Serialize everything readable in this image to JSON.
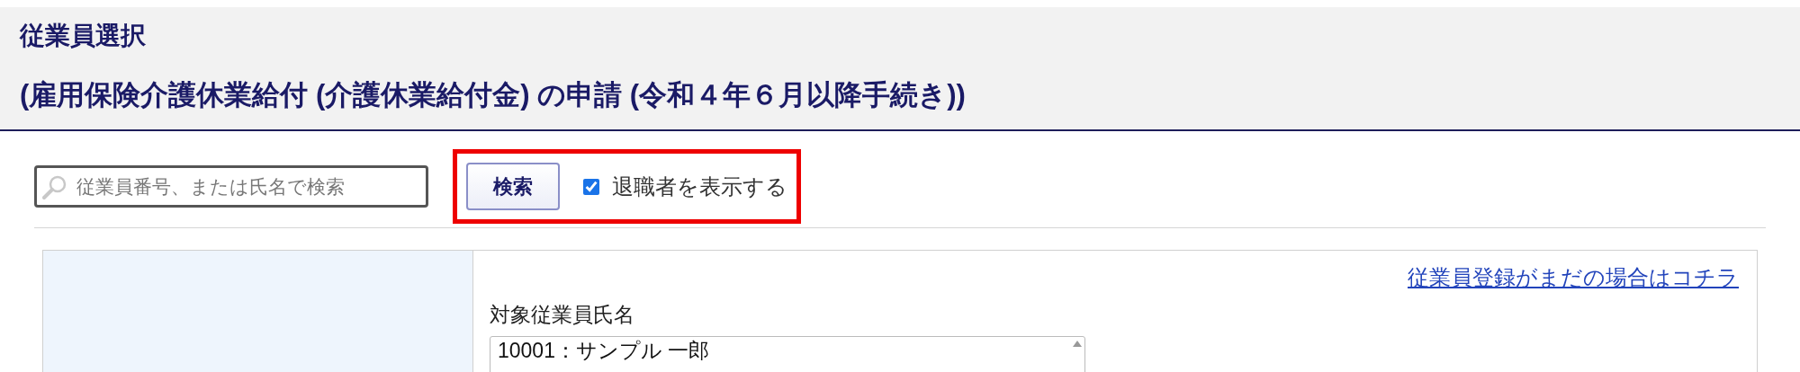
{
  "header": {
    "title": "従業員選択",
    "subtitle": "(雇用保険介護休業給付 (介護休業給付金) の申請 (令和４年６月以降手続き))"
  },
  "search": {
    "placeholder": "従業員番号、または氏名で検索"
  },
  "search_button": "検索",
  "show_retired": {
    "label": "退職者を表示する",
    "checked": true
  },
  "highlight_box": true,
  "register_link": "従業員登録がまだの場合はコチラ",
  "employee_field": {
    "label": "対象従業員氏名",
    "options": [
      "10001：サンプル 一郎"
    ]
  }
}
